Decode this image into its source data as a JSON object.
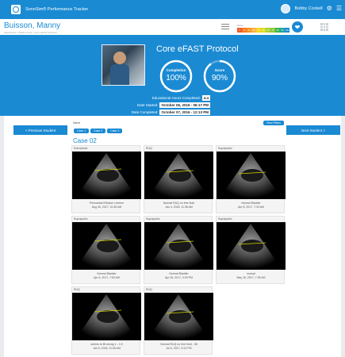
{
  "app": {
    "title": "SonoSim® Performance Tracker"
  },
  "user": {
    "name": "Bobby Cockell"
  },
  "header": {
    "student_name": "Buisson, Manny",
    "breadcrumb": "Dashboard > Student Grid > Core eFAST Protocol"
  },
  "score_scale": {
    "label": "Score",
    "cells": [
      "0",
      "10",
      "20",
      "30",
      "40",
      "50",
      "60",
      "70",
      "80",
      "90",
      "100"
    ],
    "colors": [
      "#f15a24",
      "#f47a20",
      "#f7941d",
      "#fbb040",
      "#f9d423",
      "#d7df23",
      "#a6ce39",
      "#8dc63f",
      "#39b54a",
      "#1fa3a3",
      "#1a8ad3"
    ]
  },
  "banner": {
    "protocol_title": "Core eFAST Protocol",
    "completion": {
      "label": "Completion",
      "value": "100%",
      "fraction": 1.0
    },
    "score": {
      "label": "Score",
      "value": "90%",
      "fraction": 0.9
    },
    "educational_hours_label": "Educational Hours Completed:",
    "educational_hours_value": "4.4",
    "date_started_label": "Date Started:",
    "date_started_value": "October 06, 2016 - 06:17 PM",
    "date_completed_label": "Date Completed:",
    "date_completed_value": "October 07, 2016 - 12:13 PM"
  },
  "nav": {
    "prev_label": "< Previous Student",
    "next_label": "Next Student >",
    "view_filters": "View Filters",
    "filter_label": "Name",
    "case_tabs": [
      "Case 1",
      "Case 2",
      "Case 3"
    ]
  },
  "section": {
    "title": "Case 02"
  },
  "tiles": [
    {
      "label": "Subxiphoid",
      "caption1": "Pericardial Effusion Lebrem",
      "caption2": "Aug 30, 2017, 10:45 AM"
    },
    {
      "label": "RUQ",
      "caption1": "Normal RUQ no free fluid",
      "caption2": "Jan 4, 2018, 11:36 AM"
    },
    {
      "label": "Suprapubic",
      "caption1": "Normal Bladder",
      "caption2": "Apr 8, 2017, 7:33 AM"
    },
    {
      "label": "Suprapubic",
      "caption1": "Normal Bladder",
      "caption2": "Apr 6, 2017, 7:53 AM"
    },
    {
      "label": "Suprapubic",
      "caption1": "Normal Bladder",
      "caption2": "Apr 26, 2017, 2:09 PM"
    },
    {
      "label": "Suprapubic",
      "caption1": "normal",
      "caption2": "May 16, 2017, 7:28 AM"
    },
    {
      "label": "RUQ",
      "caption1": "seems to fill strong 1 - 0.9",
      "caption2": "Jan 5, 2018, 11:06 AM"
    },
    {
      "label": "RUQ",
      "caption1": "Normal RUQ no free fluid - 98",
      "caption2": "Jul 6, 2017, 5:12 PM"
    }
  ]
}
